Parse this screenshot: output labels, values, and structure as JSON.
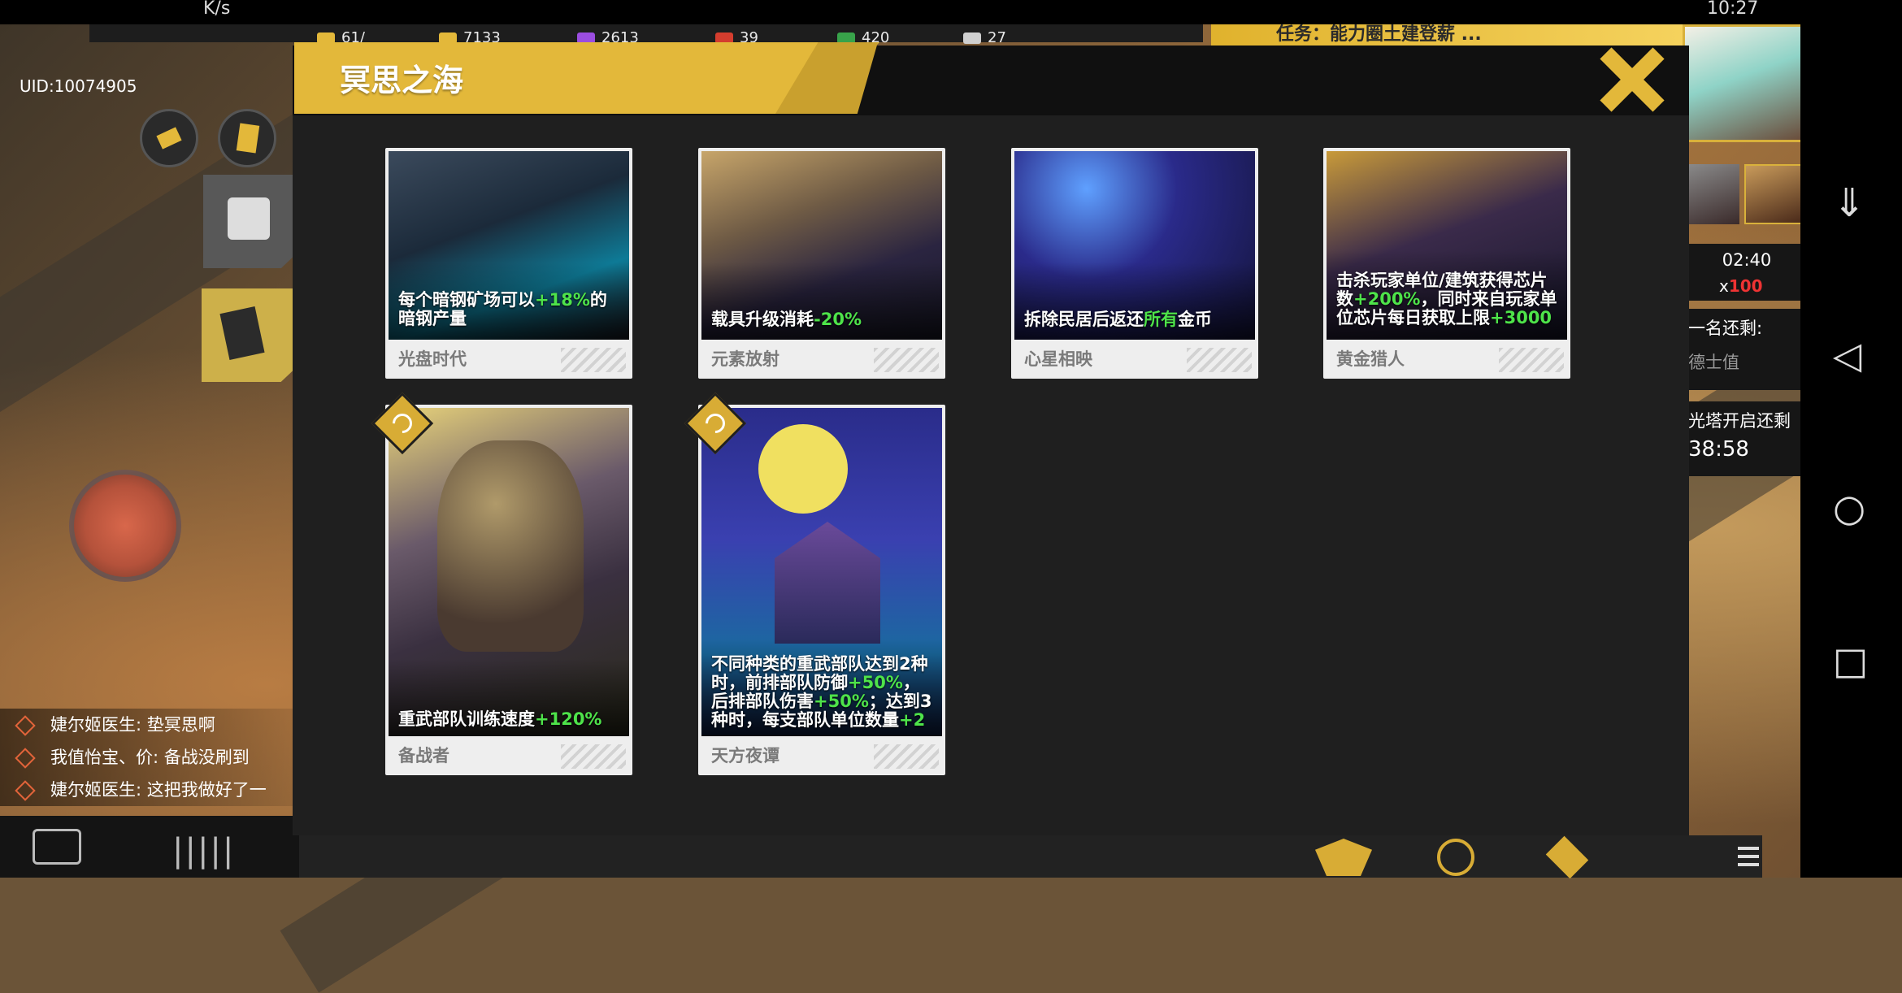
{
  "statusbar": {
    "net": "K/s",
    "time": "10:27"
  },
  "resources": {
    "level": "",
    "items": [
      {
        "value": "61/",
        "color": "#e3b83a"
      },
      {
        "value": "7133",
        "color": "#e3b83a"
      },
      {
        "value": "2613",
        "color": "#9b4de0"
      },
      {
        "value": "39",
        "color": "#d43d2e"
      },
      {
        "value": "420",
        "color": "#38a34a"
      },
      {
        "value": "27",
        "color": "#cfcfcf"
      }
    ]
  },
  "task": {
    "text": "任务：能力圈土建登薪 ..."
  },
  "player": {
    "uid": "UID:10074905"
  },
  "chat": [
    {
      "text": "婕尔姬医生: 垫冥思啊"
    },
    {
      "text": "我值怡宝、价: 备战没刷到"
    },
    {
      "text": "婕尔姬医生: 这把我做好了一"
    }
  ],
  "right_hud": {
    "timer": "02:40",
    "count_prefix": "x",
    "count_value": "100",
    "info1_title": "一名还剩:",
    "info1_sub": "德士值",
    "info2_title": "光塔开启还剩",
    "info2_time": "38:58"
  },
  "modal": {
    "title": "冥思之海",
    "cards": [
      {
        "name": "光盘时代",
        "desc_pre": "每个暗钢矿场可以",
        "desc_hl": "+18%",
        "desc_post": "的暗钢产量"
      },
      {
        "name": "元素放射",
        "desc_pre": "载具升级消耗",
        "desc_hl": "-20%",
        "desc_post": ""
      },
      {
        "name": "心星相映",
        "desc_pre": "拆除民居后返还",
        "desc_hl": "所有",
        "desc_post": "金币"
      },
      {
        "name": "黄金猎人",
        "desc_pre": "击杀玩家单位/建筑获得芯片数",
        "desc_hl": "+200%",
        "desc_mid": "，同时来自玩家单位芯片每日获取上限",
        "desc_hl2": "+3000"
      },
      {
        "name": "备战者",
        "desc_pre": "重武部队训练速度",
        "desc_hl": "+120%",
        "desc_post": ""
      },
      {
        "name": "天方夜谭",
        "desc_pre": "不同种类的重武部队达到2种时，前排部队防御",
        "desc_hl": "+50%",
        "desc_mid": "，后排部队伤害",
        "desc_hl2": "+50%",
        "desc_mid2": "；达到3种时，每支部队单位数量",
        "desc_hl3": "+2"
      }
    ]
  },
  "colors": {
    "accent": "#e3b83a",
    "green_highlight": "#4ee34a",
    "modal_bg": "#1f1f1f"
  }
}
